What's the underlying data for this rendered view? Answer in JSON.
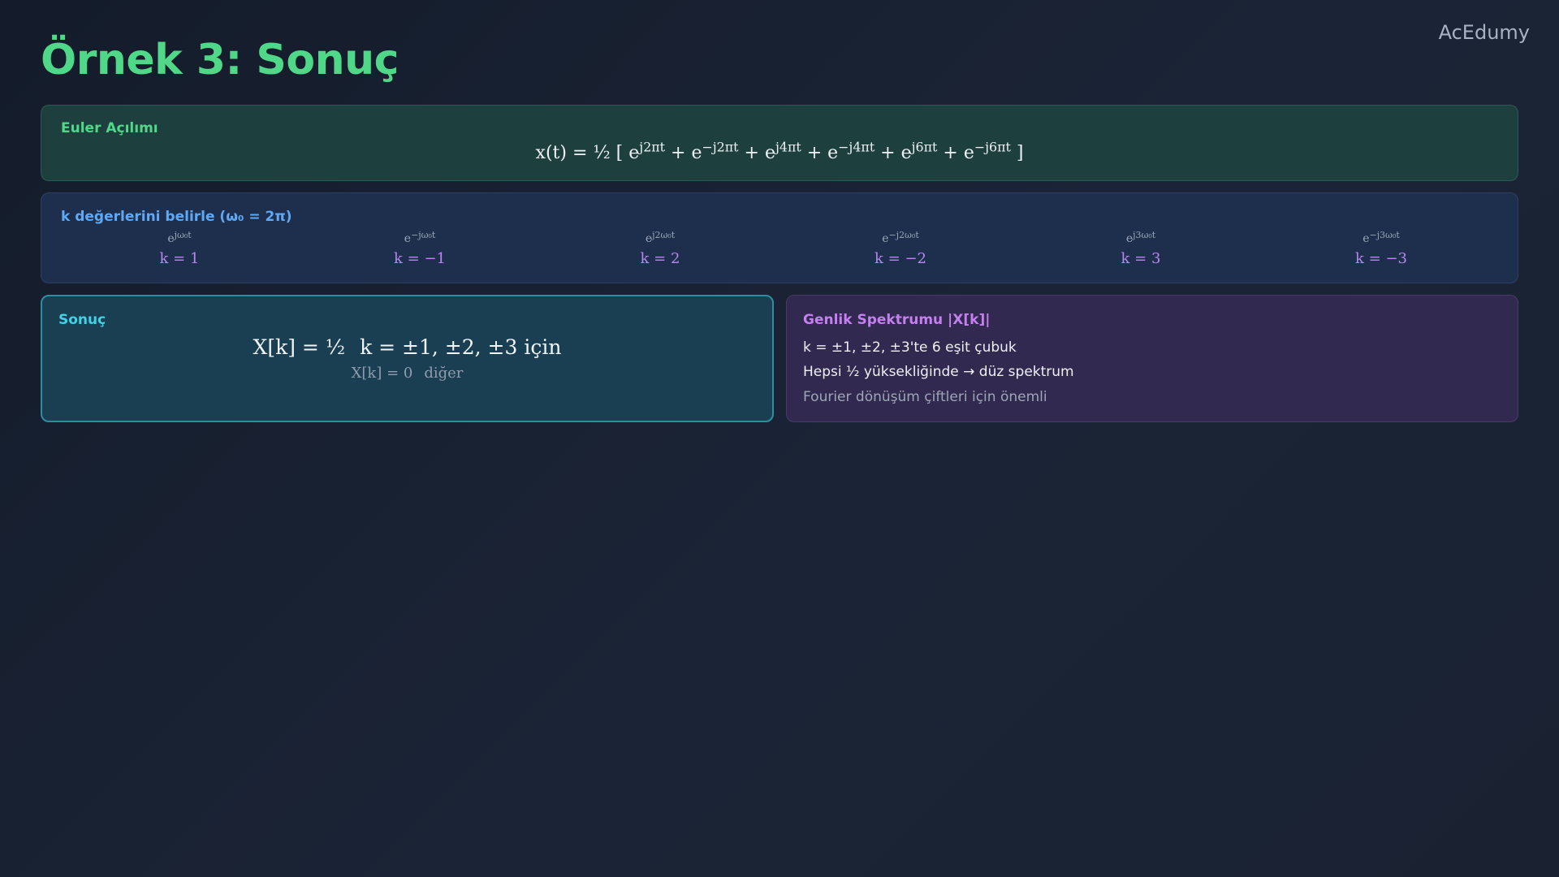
{
  "brand": "AcEdumy",
  "title": "Örnek 3: Sonuç",
  "euler": {
    "title": "Euler Açılımı",
    "prefix": "x(t) = ½ [ ",
    "terms": [
      {
        "base": "e",
        "exp": "j2πt",
        "sep": " + "
      },
      {
        "base": "e",
        "exp": "−j2πt",
        "sep": " + "
      },
      {
        "base": "e",
        "exp": "j4πt",
        "sep": " + "
      },
      {
        "base": "e",
        "exp": "−j4πt",
        "sep": " + "
      },
      {
        "base": "e",
        "exp": "j6πt",
        "sep": " + "
      },
      {
        "base": "e",
        "exp": "−j6πt",
        "sep": " "
      }
    ],
    "suffix": "]"
  },
  "k_values": {
    "title": "k değerlerini belirle (ω₀ = 2π)",
    "items": [
      {
        "base": "e",
        "exp": "jω₀t",
        "k": "k = 1"
      },
      {
        "base": "e",
        "exp": "−jω₀t",
        "k": "k = −1"
      },
      {
        "base": "e",
        "exp": "j2ω₀t",
        "k": "k = 2"
      },
      {
        "base": "e",
        "exp": "−j2ω₀t",
        "k": "k = −2"
      },
      {
        "base": "e",
        "exp": "j3ω₀t",
        "k": "k = 3"
      },
      {
        "base": "e",
        "exp": "−j3ω₀t",
        "k": "k = −3"
      }
    ]
  },
  "result": {
    "title": "Sonuç",
    "main_lhs": "X[k] = ½",
    "main_rhs": "k = ±1, ±2, ±3 için",
    "sub_lhs": "X[k] = 0",
    "sub_rhs": "diğer"
  },
  "spectrum": {
    "title": "Genlik Spektrumu |X[k]|",
    "line1": "k = ±1, ±2, ±3'te 6 eşit çubuk",
    "line2": "Hepsi ½ yüksekliğinde → düz spektrum",
    "line3": "Fourier dönüşüm çiftleri için önemli"
  }
}
